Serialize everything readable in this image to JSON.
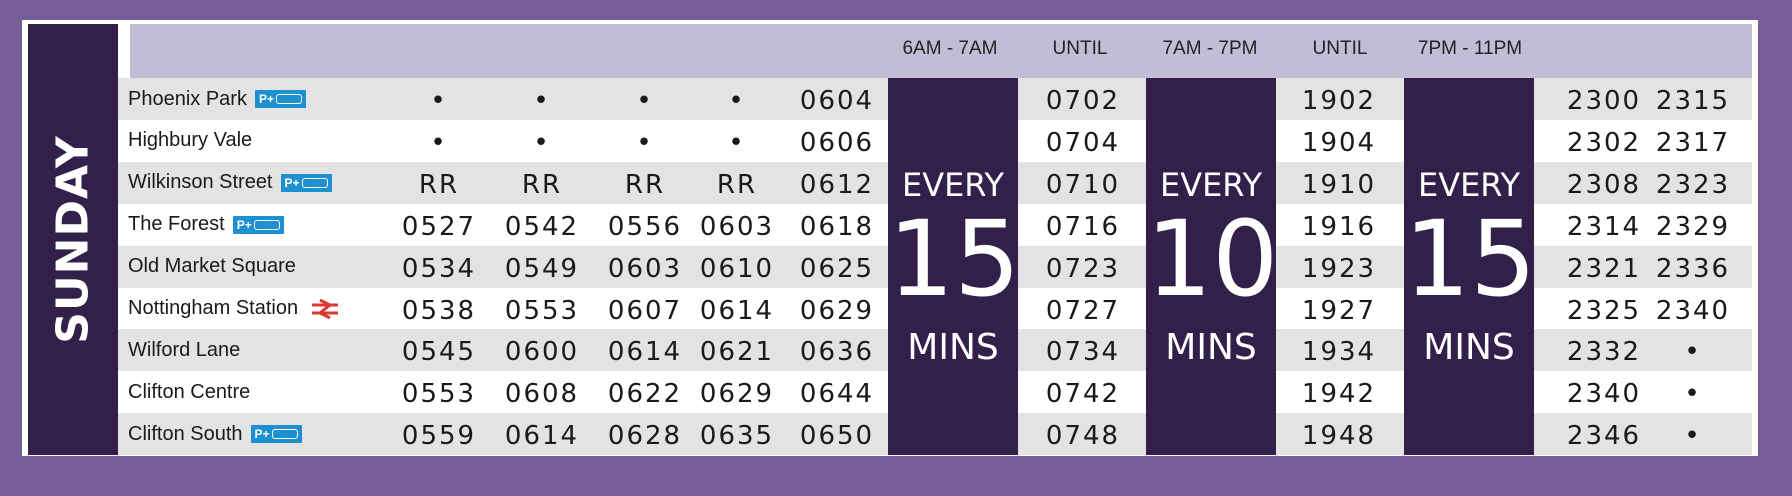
{
  "day": "SUNDAY",
  "headers": [
    "6AM - 7AM",
    "UNTIL",
    "7AM - 7PM",
    "UNTIL",
    "7PM - 11PM"
  ],
  "frequency_blocks": [
    {
      "every": "EVERY",
      "number": "15",
      "unit": "MINS"
    },
    {
      "every": "EVERY",
      "number": "10",
      "unit": "MINS"
    },
    {
      "every": "EVERY",
      "number": "15",
      "unit": "MINS"
    }
  ],
  "park_ride_label": "P+",
  "colors": {
    "background": "#765e98",
    "dark": "#33204a",
    "header": "#c3bcd6",
    "park_ride": "#1e90d0",
    "rail": "#d93a32"
  },
  "stops": [
    {
      "name": "Phoenix Park",
      "icon": "park-ride-icon",
      "times": [
        "•",
        "•",
        "•",
        "•",
        "0604",
        "0702",
        "1902",
        "2300",
        "2315"
      ]
    },
    {
      "name": "Highbury Vale",
      "icon": "",
      "times": [
        "•",
        "•",
        "•",
        "•",
        "0606",
        "0704",
        "1904",
        "2302",
        "2317"
      ]
    },
    {
      "name": "Wilkinson Street",
      "icon": "park-ride-icon",
      "times": [
        "RR",
        "RR",
        "RR",
        "RR",
        "0612",
        "0710",
        "1910",
        "2308",
        "2323"
      ]
    },
    {
      "name": "The Forest",
      "icon": "park-ride-icon",
      "times": [
        "0527",
        "0542",
        "0556",
        "0603",
        "0618",
        "0716",
        "1916",
        "2314",
        "2329"
      ]
    },
    {
      "name": "Old Market Square",
      "icon": "",
      "times": [
        "0534",
        "0549",
        "0603",
        "0610",
        "0625",
        "0723",
        "1923",
        "2321",
        "2336"
      ]
    },
    {
      "name": "Nottingham Station",
      "icon": "national-rail-icon",
      "times": [
        "0538",
        "0553",
        "0607",
        "0614",
        "0629",
        "0727",
        "1927",
        "2325",
        "2340"
      ]
    },
    {
      "name": "Wilford Lane",
      "icon": "",
      "times": [
        "0545",
        "0600",
        "0614",
        "0621",
        "0636",
        "0734",
        "1934",
        "2332",
        "•"
      ]
    },
    {
      "name": "Clifton Centre",
      "icon": "",
      "times": [
        "0553",
        "0608",
        "0622",
        "0629",
        "0644",
        "0742",
        "1942",
        "2340",
        "•"
      ]
    },
    {
      "name": "Clifton South",
      "icon": "park-ride-icon",
      "times": [
        "0559",
        "0614",
        "0628",
        "0635",
        "0650",
        "0748",
        "1948",
        "2346",
        "•"
      ]
    }
  ]
}
